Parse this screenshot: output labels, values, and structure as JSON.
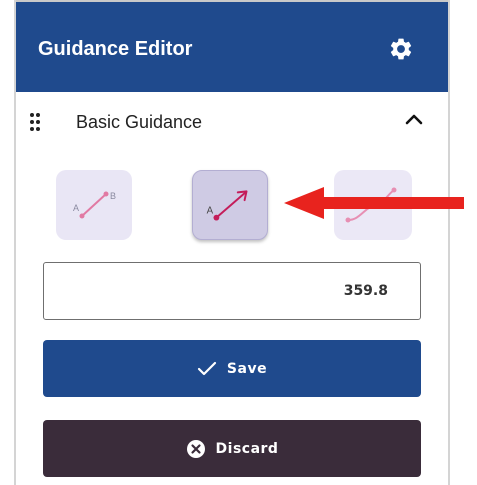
{
  "header": {
    "title": "Guidance Editor",
    "settings_icon": "gear-icon"
  },
  "section": {
    "title": "Basic Guidance",
    "drag_icon": "drag-handle-icon",
    "toggle_icon": "chevron-up-icon"
  },
  "modes": [
    {
      "icon": "ab-line-icon",
      "label_a": "A",
      "label_b": "B",
      "selected": false
    },
    {
      "icon": "a-plus-heading-icon",
      "label_a": "A",
      "selected": true
    },
    {
      "icon": "curve-icon",
      "selected": false
    }
  ],
  "heading": {
    "value": "359.8"
  },
  "actions": {
    "save_label": "Save",
    "save_icon": "check-icon",
    "discard_label": "Discard",
    "discard_icon": "close-circle-icon"
  },
  "annotation": {
    "icon": "red-arrow-icon",
    "color": "#e8231e"
  },
  "colors": {
    "header": "#1f4a8d",
    "save": "#1f4a8d",
    "discard": "#3a2c3a",
    "mode_accent": "#d6246e"
  }
}
